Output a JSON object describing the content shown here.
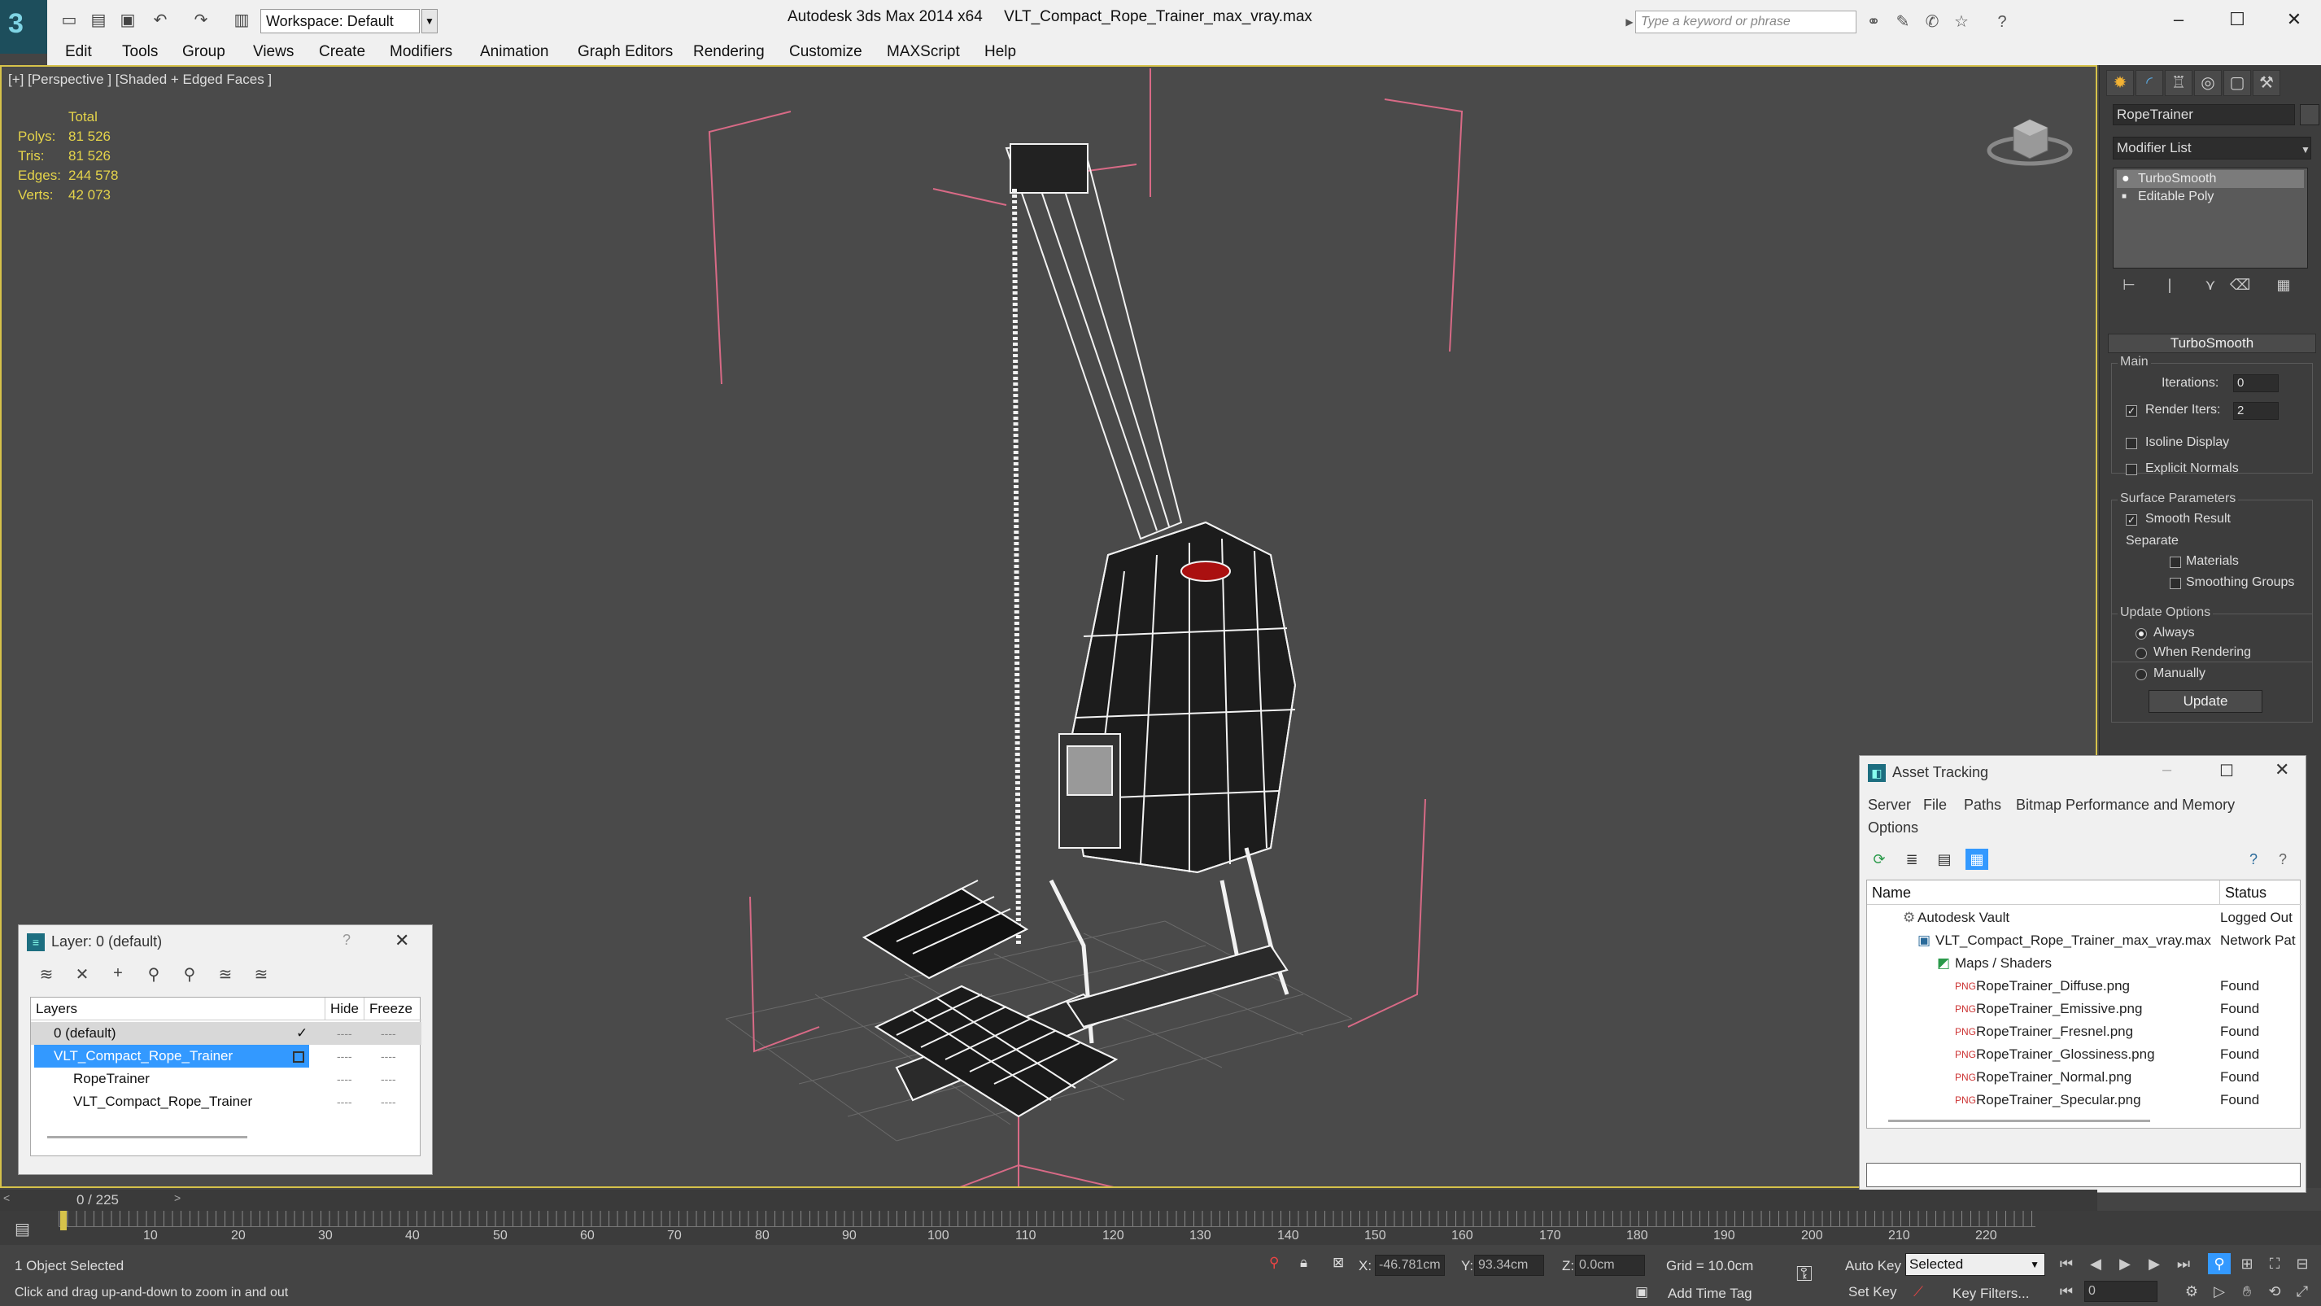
{
  "titlebar": {
    "workspace": "Workspace: Default",
    "app_title": "Autodesk 3ds Max  2014 x64",
    "file_title": "VLT_Compact_Rope_Trainer_max_vray.max",
    "search_placeholder": "Type a keyword or phrase"
  },
  "menu": [
    "Edit",
    "Tools",
    "Group",
    "Views",
    "Create",
    "Modifiers",
    "Animation",
    "Graph Editors",
    "Rendering",
    "Customize",
    "MAXScript",
    "Help"
  ],
  "viewport": {
    "label": "[+] [Perspective ] [Shaded + Edged Faces ]",
    "stats_header": "Total",
    "stats": [
      {
        "label": "Polys:",
        "value": "81 526"
      },
      {
        "label": "Tris:",
        "value": "81 526"
      },
      {
        "label": "Edges:",
        "value": "244 578"
      },
      {
        "label": "Verts:",
        "value": "42 073"
      }
    ]
  },
  "command_panel": {
    "object_name": "RopeTrainer",
    "modifier_list": "Modifier List",
    "stack": [
      "TurboSmooth",
      "Editable Poly"
    ],
    "rollout_title": "TurboSmooth",
    "main_group": "Main",
    "iterations_label": "Iterations:",
    "iterations_value": "0",
    "render_iters_label": "Render Iters:",
    "render_iters_value": "2",
    "render_iters_checked": true,
    "isoline_label": "Isoline Display",
    "explicit_normals_label": "Explicit Normals",
    "surface_group": "Surface Parameters",
    "smooth_result_label": "Smooth Result",
    "separate_label": "Separate",
    "materials_label": "Materials",
    "smoothing_groups_label": "Smoothing Groups",
    "update_group": "Update Options",
    "update_options": [
      "Always",
      "When Rendering",
      "Manually"
    ],
    "update_selected": "Always",
    "update_button": "Update"
  },
  "layer_dialog": {
    "title": "Layer: 0 (default)",
    "help": "?",
    "columns": [
      "Layers",
      "Hide",
      "Freeze"
    ],
    "rows": [
      {
        "name": "0 (default)",
        "indent": 0,
        "selected": false
      },
      {
        "name": "VLT_Compact_Rope_Trainer",
        "indent": 0,
        "selected": true
      },
      {
        "name": "RopeTrainer",
        "indent": 1,
        "selected": false
      },
      {
        "name": "VLT_Compact_Rope_Trainer",
        "indent": 1,
        "selected": false
      }
    ],
    "dash": "----"
  },
  "asset_dialog": {
    "title": "Asset Tracking",
    "menu": [
      "Server",
      "File",
      "Paths",
      "Bitmap Performance and Memory"
    ],
    "menu2": "Options",
    "columns": [
      "Name",
      "Status"
    ],
    "rows": [
      {
        "name": "Autodesk Vault",
        "status": "Logged Out",
        "indent": 1
      },
      {
        "name": "VLT_Compact_Rope_Trainer_max_vray.max",
        "status": "Network Pat",
        "indent": 2
      },
      {
        "name": "Maps / Shaders",
        "status": "",
        "indent": 3
      },
      {
        "name": "RopeTrainer_Diffuse.png",
        "status": "Found",
        "indent": 4
      },
      {
        "name": "RopeTrainer_Emissive.png",
        "status": "Found",
        "indent": 4
      },
      {
        "name": "RopeTrainer_Fresnel.png",
        "status": "Found",
        "indent": 4
      },
      {
        "name": "RopeTrainer_Glossiness.png",
        "status": "Found",
        "indent": 4
      },
      {
        "name": "RopeTrainer_Normal.png",
        "status": "Found",
        "indent": 4
      },
      {
        "name": "RopeTrainer_Specular.png",
        "status": "Found",
        "indent": 4
      }
    ]
  },
  "timeline": {
    "frame": "0 / 225",
    "ticks": [
      "10",
      "20",
      "30",
      "40",
      "50",
      "60",
      "70",
      "80",
      "90",
      "100",
      "110",
      "120",
      "130",
      "140",
      "150",
      "160",
      "170",
      "180",
      "190",
      "200",
      "210",
      "220"
    ]
  },
  "status": {
    "selection": "1 Object Selected",
    "prompt": "Click and drag up-and-down to zoom in and out",
    "x_label": "X:",
    "x_value": "-46.781cm",
    "y_label": "Y:",
    "y_value": "93.34cm",
    "z_label": "Z:",
    "z_value": "0.0cm",
    "grid": "Grid = 10.0cm",
    "add_time_tag": "Add Time Tag",
    "auto_key": "Auto Key",
    "set_key": "Set Key",
    "key_mode": "Selected",
    "key_filters": "Key Filters...",
    "current_frame": "0"
  },
  "colors": {
    "accent_blue": "#3399ff",
    "stats_yellow": "#e4d34a",
    "viewport_border": "#d6c24a",
    "bbox_pink": "#d86a86"
  }
}
